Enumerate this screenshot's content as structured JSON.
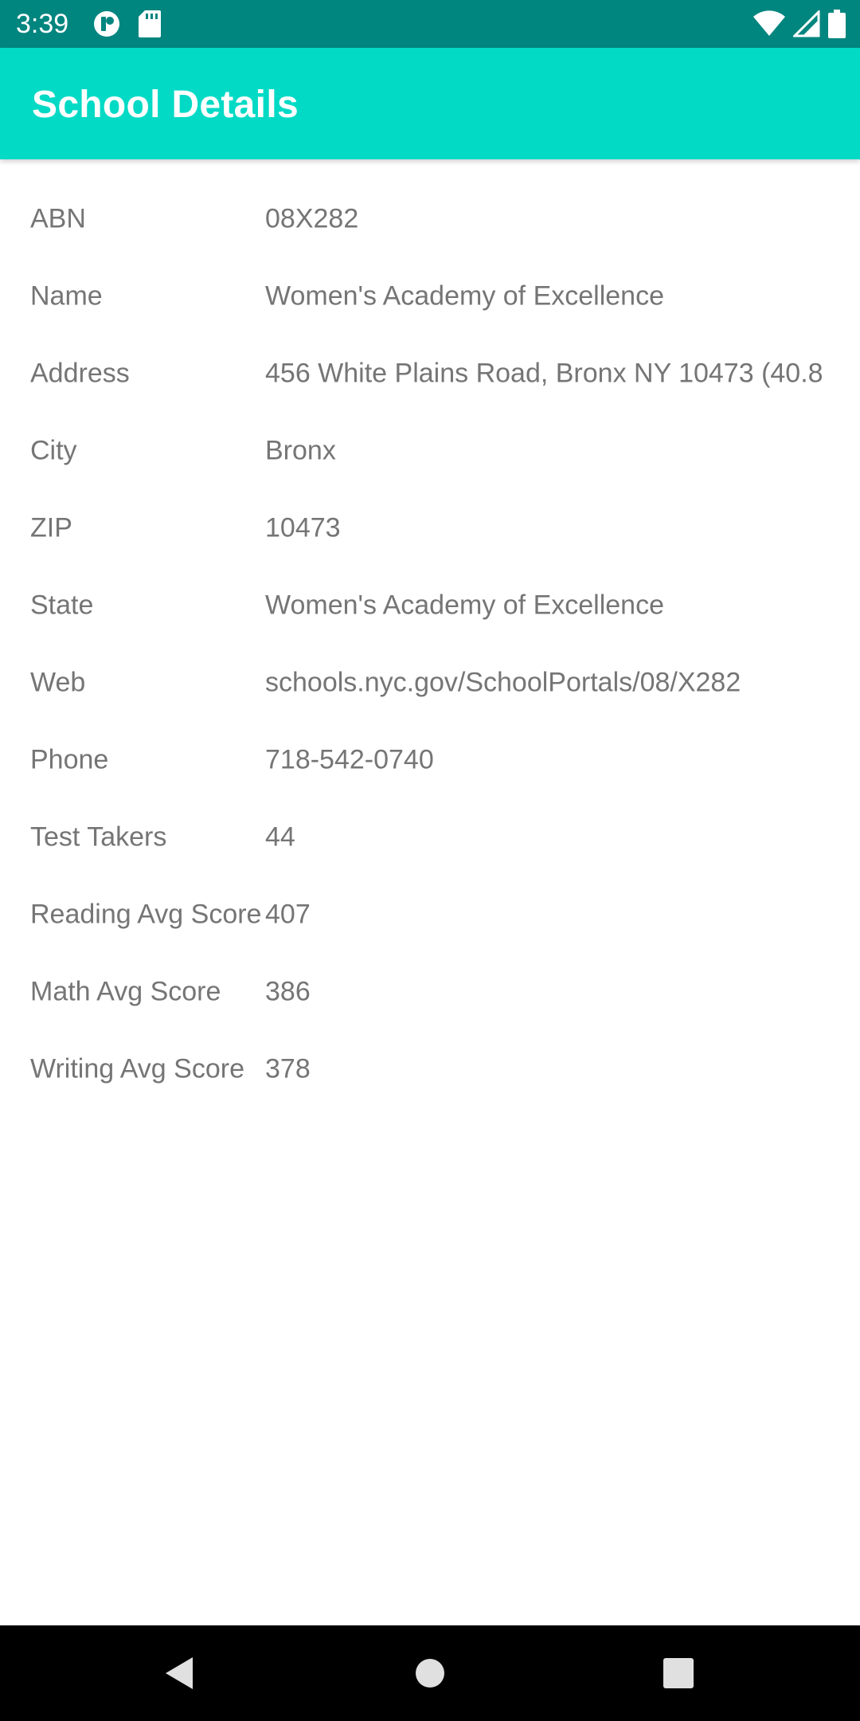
{
  "status_bar": {
    "time": "3:39",
    "left_icons": [
      "notification-icon",
      "sd-card-icon"
    ],
    "right_icons": [
      "wifi-icon",
      "signal-icon",
      "battery-icon"
    ],
    "color": "#00857f"
  },
  "app_bar": {
    "title": "School Details",
    "color": "#03dac5"
  },
  "details": [
    {
      "label": "ABN",
      "value": "08X282"
    },
    {
      "label": "Name",
      "value": "Women's Academy of Excellence"
    },
    {
      "label": "Address",
      "value": "456 White Plains Road, Bronx NY 10473 (40.8"
    },
    {
      "label": "City",
      "value": "Bronx"
    },
    {
      "label": "ZIP",
      "value": "10473"
    },
    {
      "label": "State",
      "value": "Women's Academy of Excellence"
    },
    {
      "label": "Web",
      "value": "schools.nyc.gov/SchoolPortals/08/X282"
    },
    {
      "label": "Phone",
      "value": "718-542-0740"
    },
    {
      "label": "Test Takers",
      "value": "44"
    },
    {
      "label": "Reading Avg Score",
      "value": "407"
    },
    {
      "label": "Math Avg Score",
      "value": "386"
    },
    {
      "label": "Writing Avg Score",
      "value": "378"
    }
  ],
  "nav_bar": {
    "buttons": [
      "back-icon",
      "home-icon",
      "recents-icon"
    ]
  }
}
